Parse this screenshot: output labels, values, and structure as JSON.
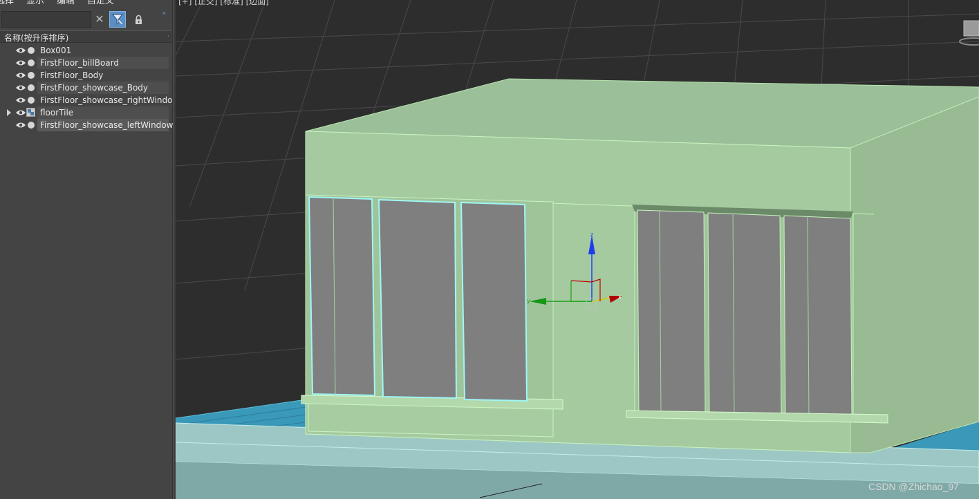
{
  "menu": {
    "select": "选择",
    "display": "显示",
    "edit": "编辑",
    "customize": "自定义"
  },
  "toolbar": {
    "search_value": "",
    "clear_icon": "close-icon",
    "filter_icon": "filter-icon",
    "lock_icon": "lock-icon",
    "more_icon": "double-chevron-right-icon"
  },
  "column_header": "名称(按升序排序)",
  "objects": [
    {
      "name": "Box001",
      "type": "object",
      "expandable": false
    },
    {
      "name": "FirstFloor_billBoard",
      "type": "object",
      "expandable": false
    },
    {
      "name": "FirstFloor_Body",
      "type": "object",
      "expandable": false
    },
    {
      "name": "FirstFloor_showcase_Body",
      "type": "object",
      "expandable": false
    },
    {
      "name": "FirstFloor_showcase_rightWindow",
      "type": "object",
      "expandable": false
    },
    {
      "name": "floorTile",
      "type": "group",
      "expandable": true
    },
    {
      "name": "FirstFloor_showcase_leftWindow",
      "type": "object",
      "expandable": false,
      "selected": true
    }
  ],
  "viewport": {
    "label": "[+] [正交] [标准] [边面]",
    "gizmo_axes": [
      "X",
      "Y",
      "Z"
    ]
  },
  "watermark": "CSDN @Zhichao_97",
  "colors": {
    "panel_bg": "#444444",
    "viewport_bg": "#2d2d2d",
    "building": "#a3c9a0",
    "selection_edge": "#8ff0f0",
    "glass": "#808080",
    "floor_tile": "#3aa0c0"
  }
}
